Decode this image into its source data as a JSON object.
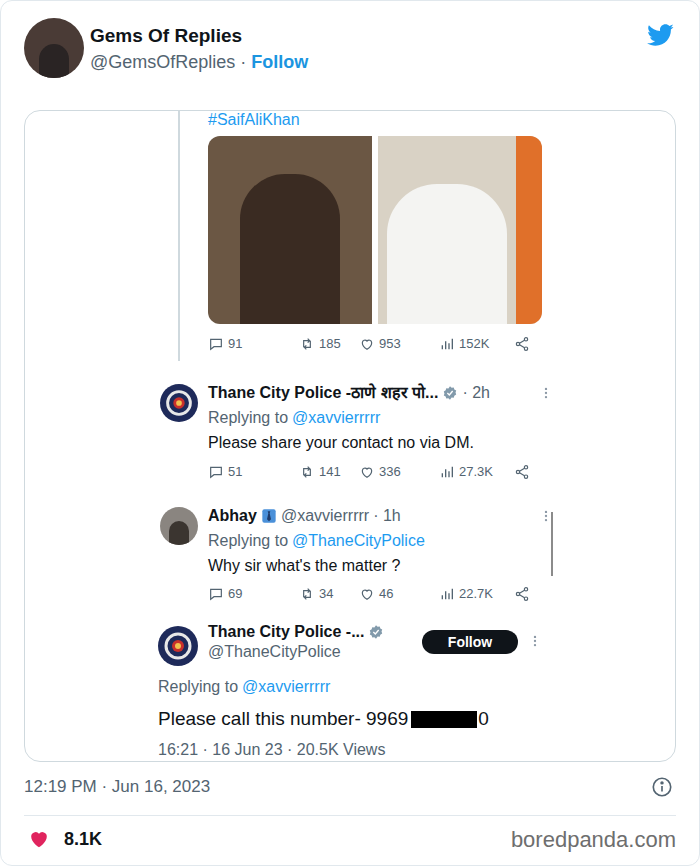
{
  "header": {
    "name": "Gems Of Replies",
    "handle": "@GemsOfReplies",
    "separator": "·",
    "follow": "Follow"
  },
  "embed": {
    "hashtag": "#SaifAliKhan",
    "post_stats": [
      "91",
      "185",
      "953",
      "152K"
    ],
    "replies": [
      {
        "name": "Thane City Police -ठाणे शहर पो...",
        "verified": true,
        "time": "· 2h",
        "replying_label": "Replying to",
        "replying_to": "@xavvierrrrr",
        "text": "Please share your contact no via DM.",
        "stats": [
          "51",
          "141",
          "336",
          "27.3K"
        ]
      },
      {
        "name": "Abhay",
        "verified": false,
        "handle": "@xavvierrrrr",
        "time": "· 1h",
        "replying_label": "Replying to",
        "replying_to": "@ThaneCityPolice",
        "text": "Why sir what's the matter ?",
        "stats": [
          "69",
          "34",
          "46",
          "22.7K"
        ]
      }
    ],
    "final": {
      "name": "Thane City Police -...",
      "verified": true,
      "handle": "@ThaneCityPolice",
      "follow": "Follow",
      "replying_label": "Replying to",
      "replying_to": "@xavvierrrrr",
      "text": "Please call this number- 9969",
      "text_tail": "0",
      "meta": "16:21 · 16 Jun 23 · 20.5K Views"
    }
  },
  "timestamp": "12:19 PM · Jun 16, 2023",
  "likes": "8.1K",
  "source": "boredpanda.com"
}
